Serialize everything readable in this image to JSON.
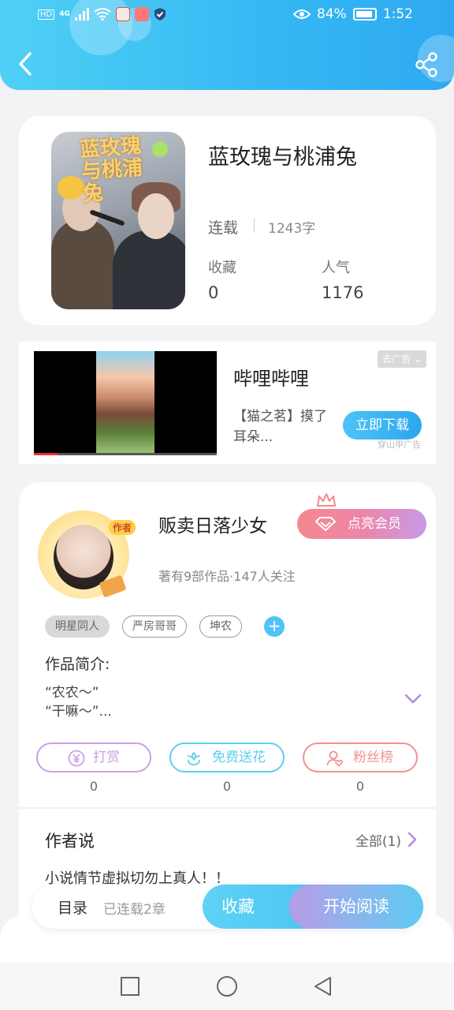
{
  "status_bar": {
    "network": "HD",
    "signal_type": "4G",
    "battery": "84%",
    "time": "1:52"
  },
  "header": {
    "back_icon": "chevron-left-icon",
    "share_icon": "share-icon"
  },
  "book": {
    "title": "蓝玫瑰与桃浦兔",
    "cover_text": "蓝玫瑰与桃浦兔",
    "status": "连载",
    "word_count": "1243字",
    "stats": [
      {
        "label": "收藏",
        "value": "0"
      },
      {
        "label": "人气",
        "value": "1176"
      }
    ]
  },
  "ad": {
    "app_name": "哔哩哔哩",
    "desc": "【猫之茗】摸了耳朵...",
    "remove_label": "去广告",
    "download_label": "立即下载",
    "note": "穿山甲广告"
  },
  "author": {
    "name": "贩卖日落少女",
    "badge": "作者",
    "vip_label": "点亮会员",
    "meta": "著有9部作品·147人关注",
    "tags": [
      "明星同人",
      "严房哥哥",
      "坤农"
    ],
    "add_tag": "+",
    "intro_label": "作品简介:",
    "intro_text": "“农农～”\n“干嘛～”...",
    "actions": [
      {
        "label": "打赏",
        "count": "0",
        "color": "#c9a0ea",
        "icon": "yen-coin-icon"
      },
      {
        "label": "免费送花",
        "count": "0",
        "color": "#5ed0ec",
        "icon": "flower-icon"
      },
      {
        "label": "粉丝榜",
        "count": "0",
        "color": "#f2928f",
        "icon": "user-heart-icon"
      }
    ],
    "say_title": "作者说",
    "say_all": "全部(1)",
    "say_text": "小说情节虚拟切勿上真人！！"
  },
  "bottom_bar": {
    "toc_label": "目录",
    "toc_status": "已连载2章",
    "fav_label": "收藏",
    "read_label": "开始阅读"
  },
  "nav": {
    "recent_icon": "square-icon",
    "home_icon": "circle-icon",
    "back_icon": "triangle-back-icon"
  }
}
